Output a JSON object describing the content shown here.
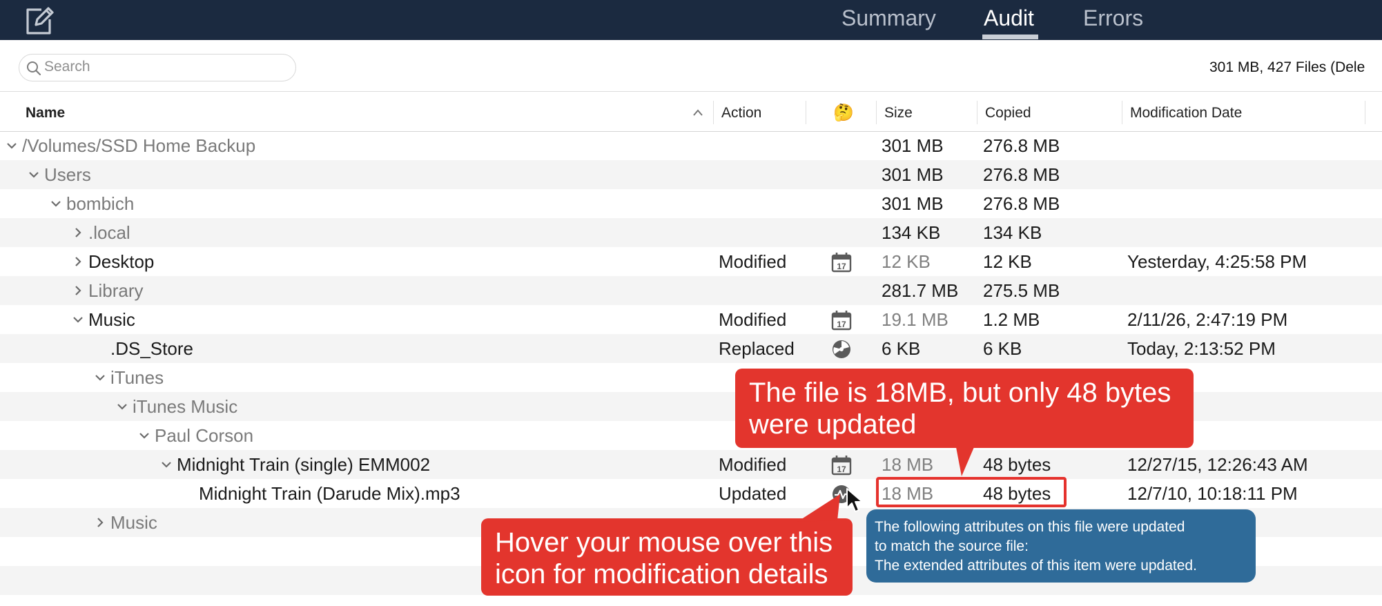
{
  "tabs": [
    {
      "label": "Summary",
      "active": false
    },
    {
      "label": "Audit",
      "active": true
    },
    {
      "label": "Errors",
      "active": false
    }
  ],
  "search": {
    "placeholder": "Search",
    "value": ""
  },
  "summary_text": "301 MB, 427 Files (Dele",
  "columns": {
    "name": "Name",
    "action": "Action",
    "reason": "🤔",
    "size": "Size",
    "copied": "Copied",
    "modification_date": "Modification Date"
  },
  "rows": [
    {
      "name": "/Volumes/SSD Home Backup",
      "action": "",
      "icon": "",
      "size": "301 MB",
      "copied": "276.8 MB",
      "date": "",
      "expanded": true,
      "level": 0
    },
    {
      "name": "Users",
      "action": "",
      "icon": "",
      "size": "301 MB",
      "copied": "276.8 MB",
      "date": "",
      "expanded": true,
      "level": 1
    },
    {
      "name": "bombich",
      "action": "",
      "icon": "",
      "size": "301 MB",
      "copied": "276.8 MB",
      "date": "",
      "expanded": true,
      "level": 2
    },
    {
      "name": ".local",
      "action": "",
      "icon": "",
      "size": "134 KB",
      "copied": "134 KB",
      "date": "",
      "expanded": false,
      "level": 3
    },
    {
      "name": "Desktop",
      "action": "Modified",
      "icon": "calendar-icon",
      "size": "12 KB",
      "copied": "12 KB",
      "date": "Yesterday, 4:25:58 PM",
      "expanded": false,
      "level": 3
    },
    {
      "name": "Library",
      "action": "",
      "icon": "",
      "size": "281.7 MB",
      "copied": "275.5 MB",
      "date": "",
      "expanded": false,
      "level": 3
    },
    {
      "name": "Music",
      "action": "Modified",
      "icon": "calendar-icon",
      "size": "19.1 MB",
      "copied": "1.2 MB",
      "date": "2/11/26, 2:47:19 PM",
      "expanded": true,
      "level": 3
    },
    {
      "name": ".DS_Store",
      "action": "Replaced",
      "icon": "replaced-icon",
      "size": "6 KB",
      "copied": "6 KB",
      "date": "Today, 2:13:52 PM",
      "expanded": null,
      "level": 4
    },
    {
      "name": "iTunes",
      "action": "",
      "icon": "",
      "size": "",
      "copied": "",
      "date": "",
      "expanded": true,
      "level": 4
    },
    {
      "name": "iTunes Music",
      "action": "",
      "icon": "",
      "size": "",
      "copied": "",
      "date": "",
      "expanded": true,
      "level": 5
    },
    {
      "name": "Paul Corson",
      "action": "",
      "icon": "",
      "size": "",
      "copied": "",
      "date": "",
      "expanded": true,
      "level": 6
    },
    {
      "name": "Midnight Train (single) EMM002",
      "action": "Modified",
      "icon": "calendar-icon",
      "size": "18 MB",
      "copied": "48 bytes",
      "date": "12/27/15, 12:26:43 AM",
      "expanded": true,
      "level": 7
    },
    {
      "name": "Midnight Train (Darude Mix).mp3",
      "action": "Updated",
      "icon": "updated-icon",
      "size": "18 MB",
      "copied": "48 bytes",
      "date": "12/7/10, 10:18:11 PM",
      "expanded": null,
      "level": 8
    },
    {
      "name": "Music",
      "action": "",
      "icon": "",
      "size": "",
      "copied": "",
      "date": "",
      "expanded": false,
      "level": 4
    }
  ],
  "callouts": {
    "top": "The file is 18MB, but only 48 bytes were updated",
    "bottom": "Hover your mouse over this icon for modification details"
  },
  "tooltip": {
    "line1": "The following attributes on this file were updated",
    "line2": "to match the source file:",
    "line3": "The extended attributes of this item were updated."
  },
  "colors": {
    "topbar": "#1b2a40",
    "callout": "#e3352d",
    "tooltip": "#2f6b99"
  }
}
